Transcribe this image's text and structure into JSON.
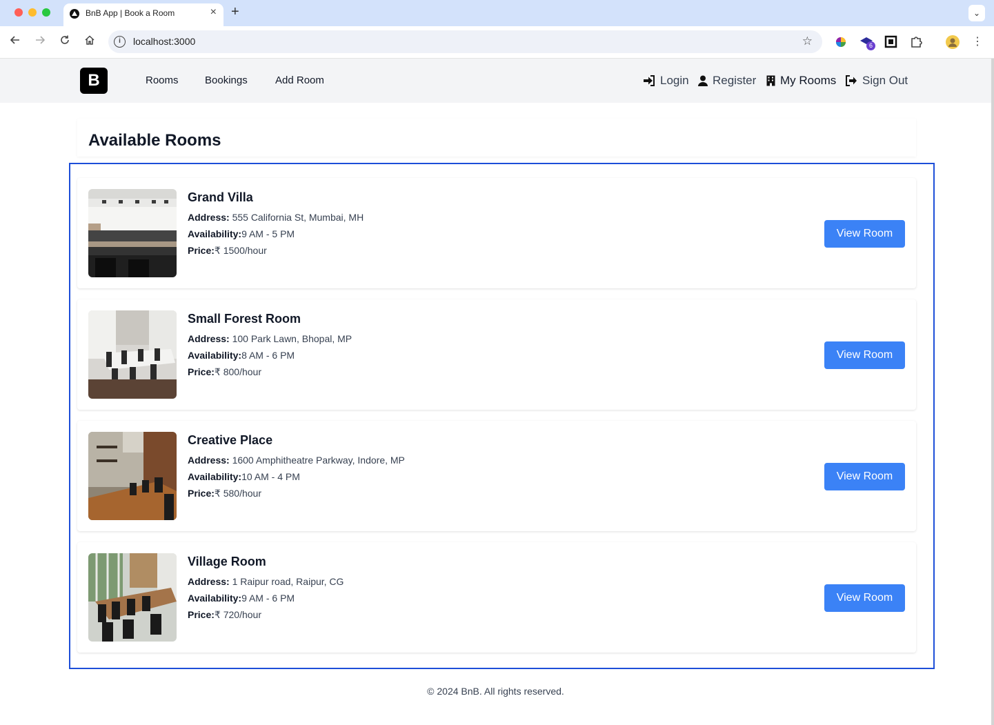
{
  "browser": {
    "tab_title": "BnB App | Book a Room",
    "url": "localhost:3000",
    "extension_badge": "6"
  },
  "nav": {
    "logo": "B",
    "links": [
      "Rooms",
      "Bookings",
      "Add Room"
    ],
    "right": {
      "login": "Login",
      "register": "Register",
      "my_rooms": "My Rooms",
      "sign_out": "Sign Out"
    }
  },
  "page": {
    "title": "Available Rooms"
  },
  "labels": {
    "address": "Address:",
    "availability": "Availability:",
    "price": "Price:",
    "view_button": "View Room"
  },
  "rooms": [
    {
      "name": "Grand Villa",
      "address": "555 California St, Mumbai, MH",
      "availability": "9 AM - 5 PM",
      "price": "₹ 1500/hour"
    },
    {
      "name": "Small Forest Room",
      "address": "100 Park Lawn, Bhopal, MP",
      "availability": "8 AM - 6 PM",
      "price": "₹ 800/hour"
    },
    {
      "name": "Creative Place",
      "address": "1600 Amphitheatre Parkway, Indore, MP",
      "availability": "10 AM - 4 PM",
      "price": "₹ 580/hour"
    },
    {
      "name": "Village Room",
      "address": "1 Raipur road, Raipur, CG",
      "availability": "9 AM - 6 PM",
      "price": "₹ 720/hour"
    }
  ],
  "footer": {
    "text": "© 2024 BnB. All rights reserved."
  },
  "colors": {
    "primary_button": "#3b82f6",
    "selection_outline": "#1d4ed8",
    "nav_background": "#f3f4f6"
  }
}
